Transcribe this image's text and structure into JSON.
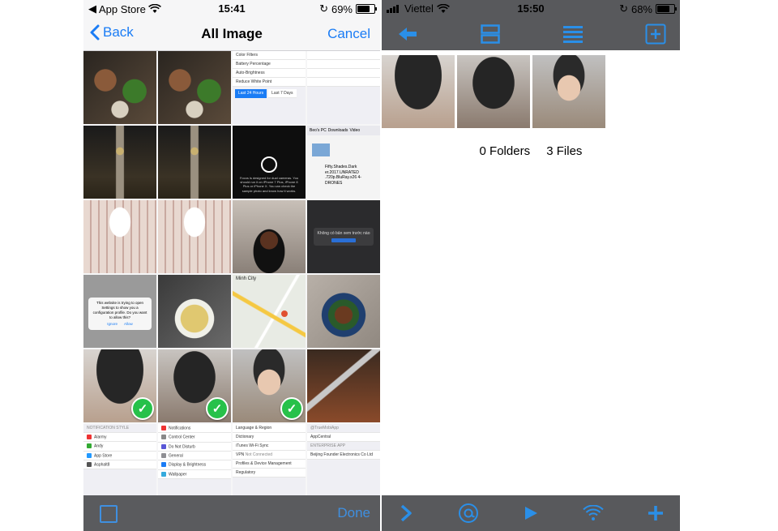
{
  "left": {
    "status": {
      "carrier": "App Store",
      "time": "15:41",
      "battery": "69%",
      "battery_level": 0.69
    },
    "nav": {
      "back_label": "Back",
      "title": "All Image",
      "cancel_label": "Cancel"
    },
    "tiles": {
      "settings_battery": [
        "Color Filters",
        "Battery Percentage",
        "Auto-Brightness",
        "Reduce White Point",
        "Last 24 Hours",
        "Last 7 Days"
      ],
      "focos_text": "Focos is designed for dual cameras. You should run it on iPhone 7 Plus, iPhone 8 Plus or iPhone X. You can check the sample photo and know how it works.",
      "files_path": [
        "Beo's PC",
        "Downloads",
        "Video"
      ],
      "files_name": "Fifty.Shades.Dark er.2017.UNRATED .720p.BluRay.x26 4-DRONES",
      "popup_text": "Không có bản xem trước nào",
      "map_title": "Minh City",
      "alert_text": "This website is trying to open Settings to show you a configuration profile. Do you want to allow this?",
      "alert_ignore": "Ignore",
      "alert_allow": "Allow",
      "notif_header": "NOTIFICATION STYLE",
      "notif_apps": [
        "Alarmy",
        "Andy",
        "App Store",
        "Asphalt8"
      ],
      "control_items": [
        "Notifications",
        "Control Center",
        "Do Not Disturb",
        "General",
        "Display & Brightness",
        "Wallpaper"
      ],
      "general_items": [
        "Language & Region",
        "Dictionary",
        "iTunes Wi-Fi Sync",
        "VPN",
        "Profiles & Device Management",
        "Regulatory"
      ],
      "vpn_status": "Not Connected",
      "profile_items": [
        "@TrueMobiApp",
        "AppCentral",
        "ENTERPRISE APP",
        "Beijing Founder Electronics Co Ltd"
      ]
    },
    "toolbar": {
      "done_label": "Done"
    }
  },
  "right": {
    "status": {
      "carrier": "Viettel",
      "time": "15:50",
      "battery": "68%",
      "battery_level": 0.68
    },
    "summary": {
      "folders": "0 Folders",
      "files": "3 Files"
    }
  },
  "colors": {
    "ios_blue": "#1a7cf5",
    "toolbar_grey": "#5a5b5e",
    "check_green": "#27c14a",
    "app_blue": "#2a8fe8"
  }
}
